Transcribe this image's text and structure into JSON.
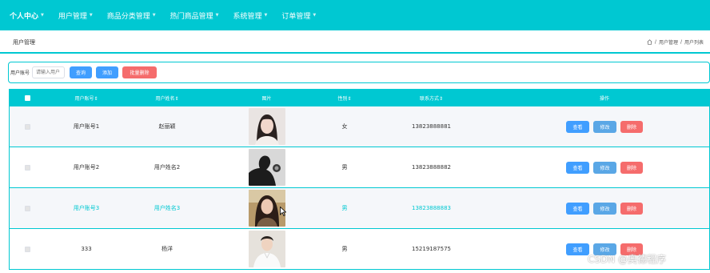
{
  "nav": {
    "items": [
      {
        "label": "个人中心"
      },
      {
        "label": "用户管理"
      },
      {
        "label": "商品分类管理"
      },
      {
        "label": "热门商品管理"
      },
      {
        "label": "系统管理"
      },
      {
        "label": "订单管理"
      }
    ]
  },
  "header": {
    "title": "用户管理",
    "breadcrumb": [
      "用户管理",
      "用户列表"
    ],
    "separator": "/"
  },
  "search": {
    "label": "用户账号",
    "placeholder": "请输入用户",
    "query_label": "查询",
    "add_label": "添加",
    "batch_delete_label": "批量删除"
  },
  "table": {
    "columns": {
      "account": "用户账号⇕",
      "name": "用户姓名⇕",
      "photo": "图片",
      "sex": "性别⇕",
      "phone": "联系方式⇕",
      "ops": "操作"
    },
    "rows": [
      {
        "account": "用户账号1",
        "name": "赵丽颖",
        "sex": "女",
        "phone": "13823888881",
        "photo_icon": "woman-portrait"
      },
      {
        "account": "用户账号2",
        "name": "用户姓名2",
        "sex": "男",
        "phone": "13823888882",
        "photo_icon": "man-silhouette"
      },
      {
        "account": "用户账号3",
        "name": "用户姓名3",
        "sex": "男",
        "phone": "13823888883",
        "photo_icon": "woman-outdoor"
      },
      {
        "account": "333",
        "name": "杨洋",
        "sex": "男",
        "phone": "15219187575",
        "photo_icon": "man-portrait"
      }
    ],
    "ops": {
      "view": "查看",
      "edit": "修改",
      "delete": "删除"
    }
  },
  "watermark": "CSDN @奥德程序",
  "colors": {
    "accent": "#00c8d2",
    "primary": "#409eff",
    "danger": "#f56c6c"
  }
}
